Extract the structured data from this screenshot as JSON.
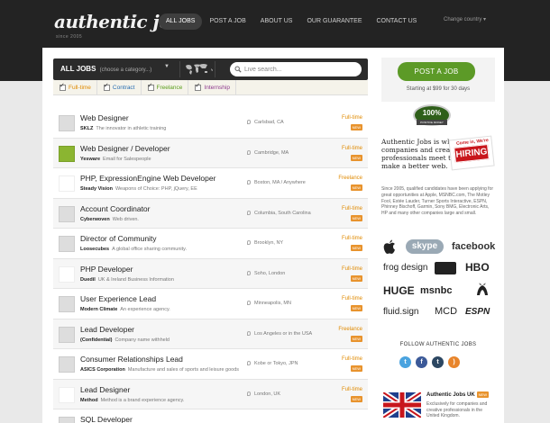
{
  "header": {
    "logo_text": "authentic jobs",
    "logo_tm": "™",
    "logo_sub": "since 2005",
    "nav": [
      {
        "label": "ALL JOBS",
        "active": true
      },
      {
        "label": "POST A JOB",
        "active": false
      },
      {
        "label": "ABOUT US",
        "active": false
      },
      {
        "label": "OUR GUARANTEE",
        "active": false
      },
      {
        "label": "CONTACT US",
        "active": false
      }
    ],
    "change_country": "Change country ▾"
  },
  "search": {
    "all_jobs": "ALL JOBS",
    "choose_category": "(choose a category...)",
    "placeholder": "Live search..."
  },
  "filters": [
    {
      "label": "Full-time",
      "color": "#e08a00"
    },
    {
      "label": "Contract",
      "color": "#2b6fb2"
    },
    {
      "label": "Freelance",
      "color": "#5b9e1c"
    },
    {
      "label": "Internship",
      "color": "#8e3a8e"
    }
  ],
  "jobs": [
    {
      "title": "Web Designer",
      "company": "SKLZ",
      "tagline": "The innovator in athletic training",
      "location": "Carlsbad, CA",
      "type": "Full-time",
      "type_color": "#e08a00",
      "new": "NEW",
      "logo": "generic"
    },
    {
      "title": "Web Designer / Developer",
      "company": "Yesware",
      "tagline": "Email for Salespeople",
      "location": "Cambridge, MA",
      "type": "Full-time",
      "type_color": "#e08a00",
      "new": "NEW",
      "logo": "yesware"
    },
    {
      "title": "PHP, ExpressionEngine Web Developer",
      "company": "Steady Vision",
      "tagline": "Weapons of Choice: PHP, jQuery, EE",
      "location": "Boston, MA / Anywhere",
      "type": "Freelance",
      "type_color": "#e08a00",
      "new": "NEW",
      "logo": "steady"
    },
    {
      "title": "Account Coordinator",
      "company": "Cyberwoven",
      "tagline": "Web driven.",
      "location": "Columbia, South Carolina",
      "type": "Full-time",
      "type_color": "#e08a00",
      "new": "NEW",
      "logo": "generic"
    },
    {
      "title": "Director of Community",
      "company": "Loosecubes",
      "tagline": "A global office sharing community.",
      "location": "Brooklyn, NY",
      "type": "Full-time",
      "type_color": "#e08a00",
      "new": "NEW",
      "logo": "generic"
    },
    {
      "title": "PHP Developer",
      "company": "Duedil",
      "tagline": "UK & Ireland Business Information",
      "location": "Soho, London",
      "type": "Full-time",
      "type_color": "#e08a00",
      "new": "NEW",
      "logo": "duedil"
    },
    {
      "title": "User Experience Lead",
      "company": "Modern Climate",
      "tagline": "An experience agency.",
      "location": "Minneapolis, MN",
      "type": "Full-time",
      "type_color": "#e08a00",
      "new": "NEW",
      "logo": "generic"
    },
    {
      "title": "Lead Developer",
      "company": "(Confidential)",
      "tagline": "Company name withheld",
      "location": "Los Angeles or in the USA",
      "type": "Freelance",
      "type_color": "#e08a00",
      "new": "NEW",
      "logo": "generic"
    },
    {
      "title": "Consumer Relationships Lead",
      "company": "ASICS Corporation",
      "tagline": "Manufacture and sales of sports and leisure goods",
      "location": "Kobe or Tokyo, JPN",
      "type": "Full-time",
      "type_color": "#e08a00",
      "new": "NEW",
      "logo": "generic"
    },
    {
      "title": "Lead Designer",
      "company": "Method",
      "tagline": "Method is a brand experience agency.",
      "location": "London, UK",
      "type": "Full-time",
      "type_color": "#e08a00",
      "new": "NEW",
      "logo": "method"
    },
    {
      "title": "SQL Developer",
      "company": "",
      "tagline": "",
      "location": "",
      "type": "",
      "type_color": "#e08a00",
      "new": "",
      "logo": "generic"
    }
  ],
  "sidebar": {
    "post_button": "POST A JOB",
    "post_price": "Starting at $99 for 30 days",
    "badge_text": "100%",
    "badge_ribbon": "POSITIVE MONEY BACK GUARANTEE",
    "promo": "Authentic Jobs is where companies and creative professionals meet to make a better web.",
    "hiring_top": "Come in, We're",
    "hiring_sign": "HIRING",
    "clients_text": "Since 2005, qualified candidates have been applying for great opportunities at Apple, MSNBC.com, The Motley Fool, Estée Lauder, Turner Sports Interactive, ESPN, Phinney Bischoff, Garmin, Sony BMG, Electronic Arts, HP and many other companies large and small.",
    "client_logos": {
      "skype": "skype",
      "facebook": "facebook",
      "frog": "frog design",
      "hbo": "HBO",
      "huge": "HUGE",
      "msnbc": "msnbc",
      "fluid": "fluid.sign",
      "mcd": "MCD",
      "espn": "ESPN"
    },
    "follow": "FOLLOW AUTHENTIC JOBS",
    "uk_title": "Authentic Jobs UK",
    "uk_new": "NEW",
    "uk_text": "Exclusively for companies and creative professionals in the United Kingdom."
  },
  "colors": {
    "header_bg": "#232323",
    "accent_green": "#5c9a27",
    "new_badge": "#e8932d"
  }
}
